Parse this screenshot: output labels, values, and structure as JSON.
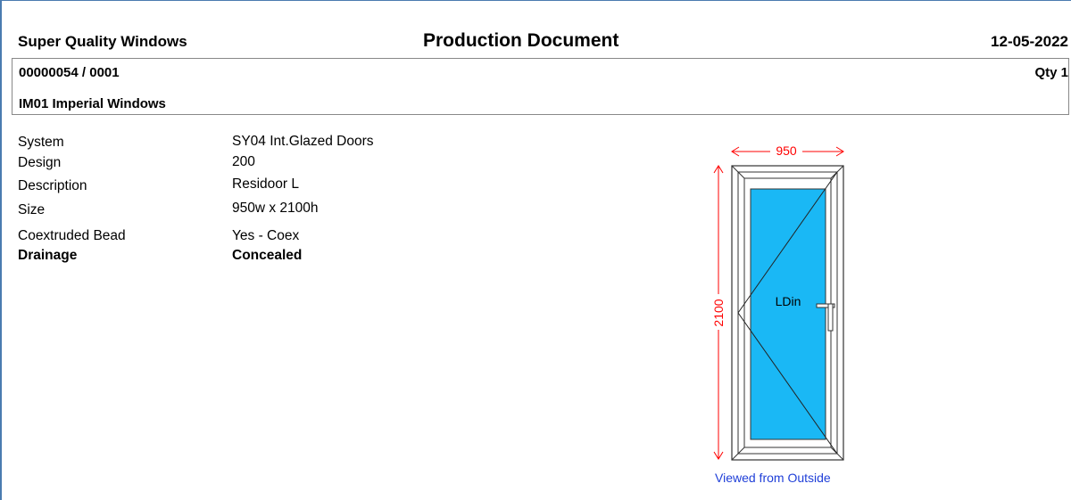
{
  "header": {
    "company": "Super Quality Windows",
    "title": "Production Document",
    "date": "12-05-2022"
  },
  "order": {
    "number": "00000054 / 0001",
    "qty": "Qty 1",
    "customer": "IM01 Imperial Windows"
  },
  "specs": [
    {
      "label": "System",
      "value": "SY04  Int.Glazed Doors",
      "bold": false
    },
    {
      "label": "Design",
      "value": "200",
      "bold": false
    },
    {
      "label": "Description",
      "value": "Residoor L",
      "bold": false
    },
    {
      "label": "Size",
      "value": "950w x 2100h",
      "bold": false
    },
    {
      "label": "Coextruded Bead",
      "value": "Yes - Coex",
      "bold": false
    },
    {
      "label": "Drainage",
      "value": "Concealed",
      "bold": true
    }
  ],
  "drawing": {
    "width_dim": "950",
    "height_dim": "2100",
    "opening_label": "LDin",
    "caption": "Viewed from Outside",
    "glass_color": "#1ab8f5",
    "dim_color": "#ff0000"
  }
}
